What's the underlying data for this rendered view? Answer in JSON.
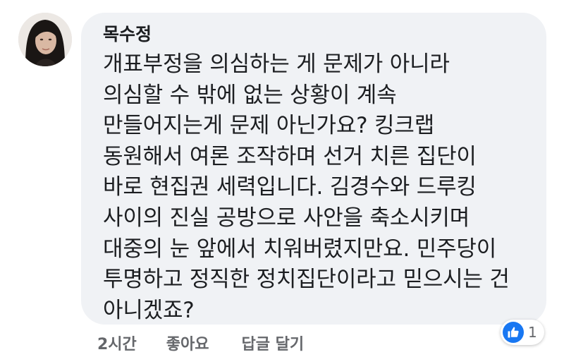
{
  "comment": {
    "author": "목수정",
    "lines": [
      "개표부정을 의심하는 게 문제가 아니라",
      "의심할 수 밖에 없는 상황이 계속",
      "만들어지는게 문제 아닌가요? 킹크랩",
      "동원해서 여론 조작하며 선거 치른 집단이",
      "바로 현집권 세력입니다. 김경수와 드루킹",
      "사이의 진실 공방으로 사안을 축소시키며",
      "대중의 눈 앞에서 치워버렸지만요. 민주당이",
      "투명하고 정직한 정치집단이라고 믿으시는 건",
      "아니겠죠?"
    ]
  },
  "actions": {
    "time": "2시간",
    "like_label": "좋아요",
    "reply_label": "답글 달기"
  },
  "reactions": {
    "icon": "thumbs-up-icon",
    "count": "1",
    "color": "#1877f2"
  },
  "colors": {
    "bubble": "#f0f2f5",
    "text": "#1c1e21",
    "meta": "#65676b"
  }
}
